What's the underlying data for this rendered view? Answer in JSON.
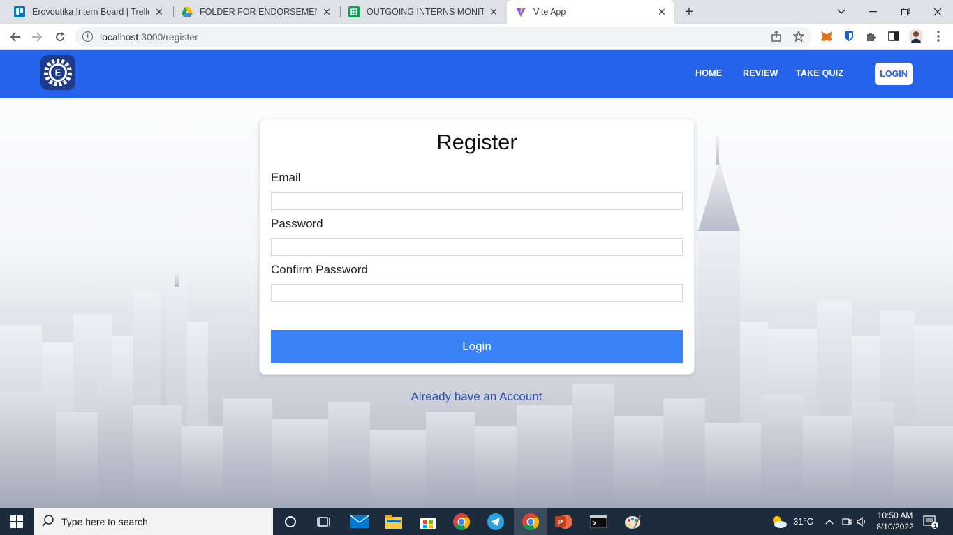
{
  "browser": {
    "tabs": [
      {
        "title": "Erovoutika Intern Board | Trello",
        "favicon": "trello-icon",
        "color": "#0079bf"
      },
      {
        "title": "FOLDER FOR ENDORSEMENT BA",
        "favicon": "google-drive-icon",
        "color": "#1fa463"
      },
      {
        "title": "OUTGOING INTERNS MONITORIN",
        "favicon": "google-sheets-icon",
        "color": "#0f9d58"
      },
      {
        "title": "Vite App",
        "favicon": "vite-icon",
        "color": "#8b5cf6"
      }
    ],
    "active_tab": 3,
    "url_host": "localhost",
    "url_rest": ":3000/register"
  },
  "nav": {
    "links": [
      "HOME",
      "REVIEW",
      "TAKE QUIZ"
    ],
    "login_label": "LOGIN"
  },
  "form": {
    "title": "Register",
    "email_label": "Email",
    "password_label": "Password",
    "confirm_label": "Confirm Password",
    "submit_label": "Login",
    "already_link": "Already have an Account"
  },
  "taskbar": {
    "search_placeholder": "Type here to search",
    "temperature": "31°C",
    "time": "10:50 AM",
    "date": "8/10/2022",
    "notification_count": "1"
  },
  "colors": {
    "navbar": "#2563eb",
    "button": "#3b82f6",
    "link": "#2d4fb3"
  }
}
